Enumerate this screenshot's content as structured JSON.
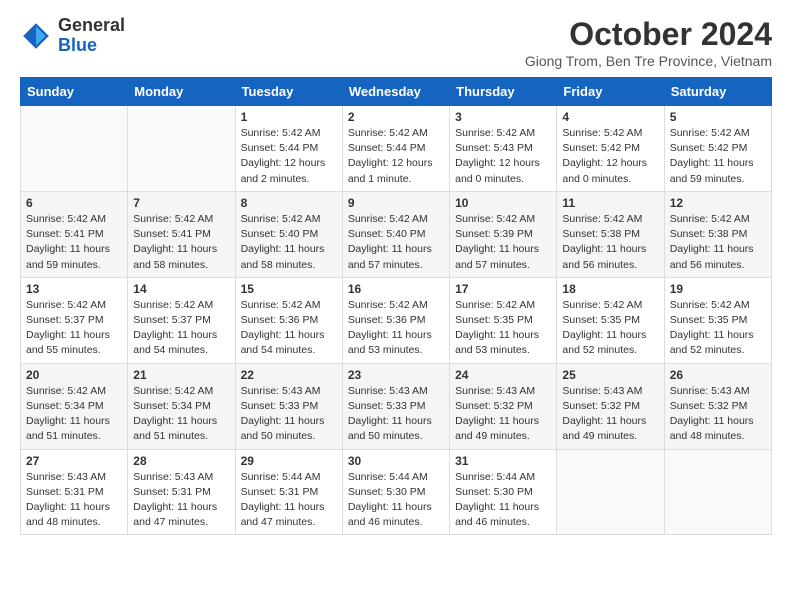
{
  "header": {
    "logo_general": "General",
    "logo_blue": "Blue",
    "month_title": "October 2024",
    "location": "Giong Trom, Ben Tre Province, Vietnam"
  },
  "calendar": {
    "weekdays": [
      "Sunday",
      "Monday",
      "Tuesday",
      "Wednesday",
      "Thursday",
      "Friday",
      "Saturday"
    ],
    "weeks": [
      [
        {
          "day": "",
          "info": ""
        },
        {
          "day": "",
          "info": ""
        },
        {
          "day": "1",
          "info": "Sunrise: 5:42 AM\nSunset: 5:44 PM\nDaylight: 12 hours\nand 2 minutes."
        },
        {
          "day": "2",
          "info": "Sunrise: 5:42 AM\nSunset: 5:44 PM\nDaylight: 12 hours\nand 1 minute."
        },
        {
          "day": "3",
          "info": "Sunrise: 5:42 AM\nSunset: 5:43 PM\nDaylight: 12 hours\nand 0 minutes."
        },
        {
          "day": "4",
          "info": "Sunrise: 5:42 AM\nSunset: 5:42 PM\nDaylight: 12 hours\nand 0 minutes."
        },
        {
          "day": "5",
          "info": "Sunrise: 5:42 AM\nSunset: 5:42 PM\nDaylight: 11 hours\nand 59 minutes."
        }
      ],
      [
        {
          "day": "6",
          "info": "Sunrise: 5:42 AM\nSunset: 5:41 PM\nDaylight: 11 hours\nand 59 minutes."
        },
        {
          "day": "7",
          "info": "Sunrise: 5:42 AM\nSunset: 5:41 PM\nDaylight: 11 hours\nand 58 minutes."
        },
        {
          "day": "8",
          "info": "Sunrise: 5:42 AM\nSunset: 5:40 PM\nDaylight: 11 hours\nand 58 minutes."
        },
        {
          "day": "9",
          "info": "Sunrise: 5:42 AM\nSunset: 5:40 PM\nDaylight: 11 hours\nand 57 minutes."
        },
        {
          "day": "10",
          "info": "Sunrise: 5:42 AM\nSunset: 5:39 PM\nDaylight: 11 hours\nand 57 minutes."
        },
        {
          "day": "11",
          "info": "Sunrise: 5:42 AM\nSunset: 5:38 PM\nDaylight: 11 hours\nand 56 minutes."
        },
        {
          "day": "12",
          "info": "Sunrise: 5:42 AM\nSunset: 5:38 PM\nDaylight: 11 hours\nand 56 minutes."
        }
      ],
      [
        {
          "day": "13",
          "info": "Sunrise: 5:42 AM\nSunset: 5:37 PM\nDaylight: 11 hours\nand 55 minutes."
        },
        {
          "day": "14",
          "info": "Sunrise: 5:42 AM\nSunset: 5:37 PM\nDaylight: 11 hours\nand 54 minutes."
        },
        {
          "day": "15",
          "info": "Sunrise: 5:42 AM\nSunset: 5:36 PM\nDaylight: 11 hours\nand 54 minutes."
        },
        {
          "day": "16",
          "info": "Sunrise: 5:42 AM\nSunset: 5:36 PM\nDaylight: 11 hours\nand 53 minutes."
        },
        {
          "day": "17",
          "info": "Sunrise: 5:42 AM\nSunset: 5:35 PM\nDaylight: 11 hours\nand 53 minutes."
        },
        {
          "day": "18",
          "info": "Sunrise: 5:42 AM\nSunset: 5:35 PM\nDaylight: 11 hours\nand 52 minutes."
        },
        {
          "day": "19",
          "info": "Sunrise: 5:42 AM\nSunset: 5:35 PM\nDaylight: 11 hours\nand 52 minutes."
        }
      ],
      [
        {
          "day": "20",
          "info": "Sunrise: 5:42 AM\nSunset: 5:34 PM\nDaylight: 11 hours\nand 51 minutes."
        },
        {
          "day": "21",
          "info": "Sunrise: 5:42 AM\nSunset: 5:34 PM\nDaylight: 11 hours\nand 51 minutes."
        },
        {
          "day": "22",
          "info": "Sunrise: 5:43 AM\nSunset: 5:33 PM\nDaylight: 11 hours\nand 50 minutes."
        },
        {
          "day": "23",
          "info": "Sunrise: 5:43 AM\nSunset: 5:33 PM\nDaylight: 11 hours\nand 50 minutes."
        },
        {
          "day": "24",
          "info": "Sunrise: 5:43 AM\nSunset: 5:32 PM\nDaylight: 11 hours\nand 49 minutes."
        },
        {
          "day": "25",
          "info": "Sunrise: 5:43 AM\nSunset: 5:32 PM\nDaylight: 11 hours\nand 49 minutes."
        },
        {
          "day": "26",
          "info": "Sunrise: 5:43 AM\nSunset: 5:32 PM\nDaylight: 11 hours\nand 48 minutes."
        }
      ],
      [
        {
          "day": "27",
          "info": "Sunrise: 5:43 AM\nSunset: 5:31 PM\nDaylight: 11 hours\nand 48 minutes."
        },
        {
          "day": "28",
          "info": "Sunrise: 5:43 AM\nSunset: 5:31 PM\nDaylight: 11 hours\nand 47 minutes."
        },
        {
          "day": "29",
          "info": "Sunrise: 5:44 AM\nSunset: 5:31 PM\nDaylight: 11 hours\nand 47 minutes."
        },
        {
          "day": "30",
          "info": "Sunrise: 5:44 AM\nSunset: 5:30 PM\nDaylight: 11 hours\nand 46 minutes."
        },
        {
          "day": "31",
          "info": "Sunrise: 5:44 AM\nSunset: 5:30 PM\nDaylight: 11 hours\nand 46 minutes."
        },
        {
          "day": "",
          "info": ""
        },
        {
          "day": "",
          "info": ""
        }
      ]
    ]
  }
}
